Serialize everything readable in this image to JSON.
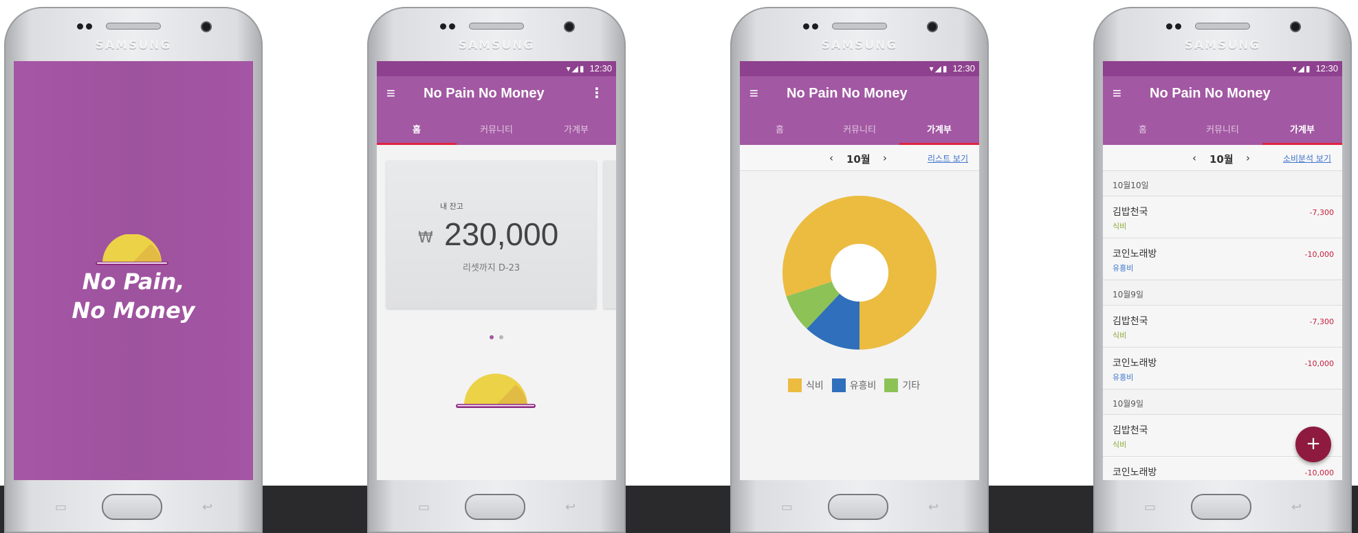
{
  "brand": "SAMSUNG",
  "colors": {
    "primary": "#a258a2",
    "primary_dark": "#8e418e",
    "tab_indicator": "#e0233f",
    "expense": "#c21d3a",
    "fab": "#8e1b3f",
    "food": "#ebbc40",
    "entertainment": "#2f6fbb",
    "other": "#8dc257"
  },
  "splash": {
    "title_line1": "No Pain,",
    "title_line2": "No Money"
  },
  "status": {
    "time": "12:30",
    "icons": "▾◢▮"
  },
  "appbar": {
    "title": "No Pain No Money",
    "menu_icon": "≡",
    "more_icon": "⋮"
  },
  "tabs": [
    {
      "label": "홈"
    },
    {
      "label": "커뮤니티"
    },
    {
      "label": "가계부"
    }
  ],
  "home": {
    "balance_label": "내 잔고",
    "currency": "₩",
    "balance": "230,000",
    "dday": "리셋까지 D-23",
    "page_count": 2,
    "page_index": 0
  },
  "month_nav": {
    "prev": "‹",
    "next": "›",
    "month": "10월",
    "list_link": "리스트 보기",
    "analysis_link": "소비분석 보기"
  },
  "chart_data": {
    "type": "pie",
    "categories": [
      "식비",
      "유흥비",
      "기타"
    ],
    "values": [
      80,
      12,
      8
    ],
    "colors": [
      "#ebbc40",
      "#2f6fbb",
      "#8dc257"
    ]
  },
  "ledger": {
    "groups": [
      {
        "date": "10월10일",
        "items": [
          {
            "name": "김밥천국",
            "category": "식비",
            "category_color": "#8aa833",
            "amount": "-7,300"
          },
          {
            "name": "코인노래방",
            "category": "유흥비",
            "category_color": "#3b72c8",
            "amount": "-10,000"
          }
        ]
      },
      {
        "date": "10월9일",
        "items": [
          {
            "name": "김밥천국",
            "category": "식비",
            "category_color": "#8aa833",
            "amount": "-7,300"
          },
          {
            "name": "코인노래방",
            "category": "유흥비",
            "category_color": "#3b72c8",
            "amount": "-10,000"
          }
        ]
      },
      {
        "date": "10월9일",
        "items": [
          {
            "name": "김밥천국",
            "category": "식비",
            "category_color": "#8aa833",
            "amount": ""
          },
          {
            "name": "코인노래방",
            "category": "",
            "category_color": "#3b72c8",
            "amount": "-10,000"
          }
        ]
      }
    ],
    "fab_label": "+"
  }
}
